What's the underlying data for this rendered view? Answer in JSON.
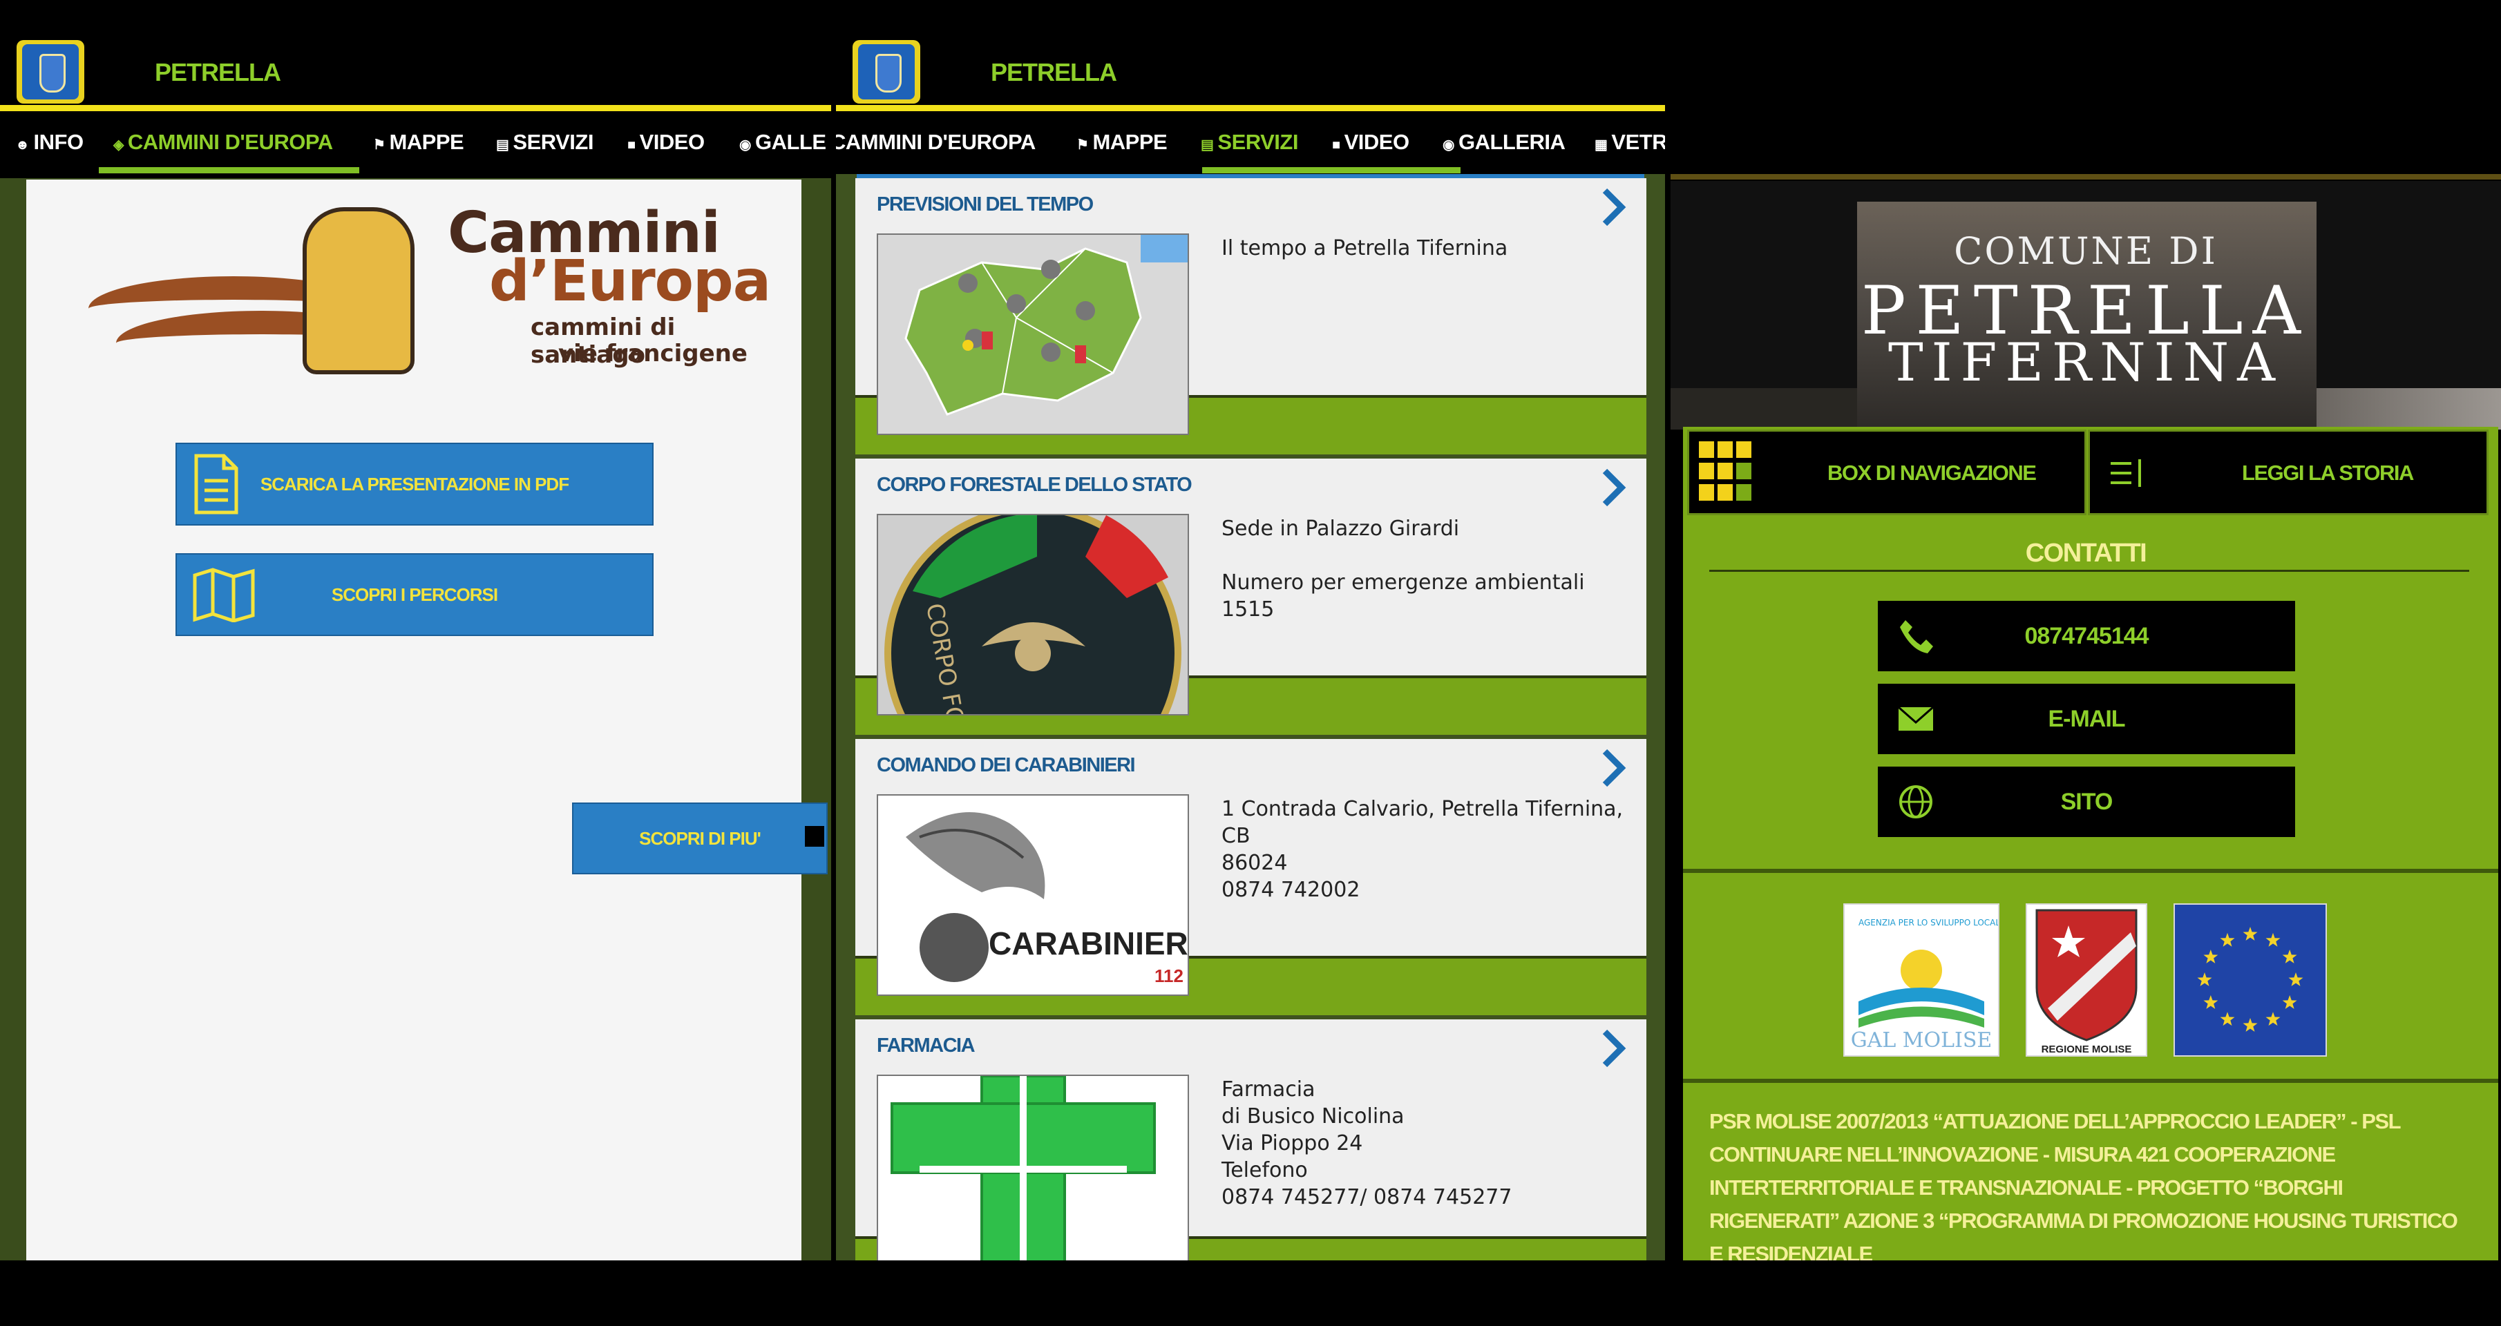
{
  "colors": {
    "accent_green": "#7cab17",
    "tab_active": "#8ecf2a",
    "header_line": "#f2e21b",
    "blue": "#2a7fc5",
    "service_title": "#1d5b8f"
  },
  "panel1": {
    "app_title": "PETRELLA",
    "tabs": [
      {
        "label": "INFO",
        "icon": "people-icon"
      },
      {
        "label": "CAMMINI D'EUROPA",
        "icon": "globe-icon",
        "active": true
      },
      {
        "label": "MAPPE",
        "icon": "flag-icon"
      },
      {
        "label": "SERVIZI",
        "icon": "briefcase-icon"
      },
      {
        "label": "VIDEO",
        "icon": "video-icon"
      },
      {
        "label": "GALLE",
        "icon": "camera-icon"
      }
    ],
    "logo": {
      "line1": "Cammini",
      "line2": "d’Europa",
      "line3": "cammini di santiago",
      "line4": "vie francigene"
    },
    "buttons": {
      "pdf": "SCARICA LA PRESENTAZIONE IN PDF",
      "percorsi": "SCOPRI I PERCORSI",
      "more": "SCOPRI DI PIU'"
    }
  },
  "panel2": {
    "app_title": "PETRELLA",
    "tabs": [
      {
        "label": "CAMMINI D'EUROPA",
        "icon": ""
      },
      {
        "label": "MAPPE",
        "icon": "flag-icon"
      },
      {
        "label": "SERVIZI",
        "icon": "briefcase-icon",
        "active": true
      },
      {
        "label": "VIDEO",
        "icon": "video-icon"
      },
      {
        "label": "GALLERIA",
        "icon": "camera-icon"
      },
      {
        "label": "VETR",
        "icon": "grid-icon"
      }
    ],
    "services": [
      {
        "title": "PREVISIONI DEL TEMPO",
        "desc": "Il tempo a Petrella Tifernina",
        "image": "weather-map"
      },
      {
        "title": "CORPO FORESTALE DELLO STATO",
        "desc": "Sede in Palazzo Girardi\n\nNumero per emergenze ambientali\n1515",
        "image": "forestale-badge"
      },
      {
        "title": "COMANDO DEI CARABINIERI",
        "desc": "1 Contrada Calvario, Petrella Tifernina, CB\n86024\n0874 742002",
        "image": "carabinieri-logo"
      },
      {
        "title": "FARMACIA",
        "desc": "Farmacia\ndi Busico Nicolina\nVia Pioppo 24\nTelefono\n0874 745277/ 0874 745277",
        "image": "pharmacy-cross"
      }
    ],
    "image_text": {
      "forestale": "CORPO FORESTALE DELLO STATO",
      "carabinieri": "CARABINIERI",
      "carabinieri_num": "112"
    }
  },
  "panel3": {
    "banner": {
      "line1": "COMUNE DI",
      "line2": "PETRELLA",
      "line3": "TIFERNINA"
    },
    "nav": {
      "box": "BOX DI NAVIGAZIONE",
      "storia": "LEGGI LA STORIA"
    },
    "contacts_title": "CONTATTI",
    "contacts": [
      {
        "label": "0874745144",
        "icon": "phone-icon"
      },
      {
        "label": "E-MAIL",
        "icon": "mail-icon"
      },
      {
        "label": "SITO",
        "icon": "globe-icon"
      }
    ],
    "logos": {
      "gal": "GAL MOLISE",
      "gal_arc": "AGENZIA PER LO SVILUPPO LOCALE",
      "regione": "REGIONE MOLISE"
    },
    "footer": "PSR MOLISE 2007/2013 “ATTUAZIONE DELL’APPROCCIO LEADER” - PSL CONTINUARE NELL’INNOVAZIONE - MISURA 421 COOPERAZIONE INTERTERRITORIALE E TRANSNAZIONALE - PROGETTO “BORGHI RIGENERATI” AZIONE 3 “PROGRAMMA DI PROMOZIONE HOUSING TURISTICO E RESIDENZIALE"
  }
}
